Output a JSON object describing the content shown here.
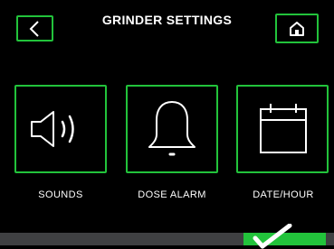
{
  "header": {
    "title": "GRINDER SETTINGS",
    "back_icon": "chevron-left-icon",
    "home_icon": "home-icon"
  },
  "tiles": [
    {
      "label": "SOUNDS",
      "icon": "speaker-icon"
    },
    {
      "label": "DOSE ALARM",
      "icon": "bell-icon"
    },
    {
      "label": "DATE/HOUR",
      "icon": "calendar-icon"
    }
  ],
  "colors": {
    "accent": "#22c33b",
    "background": "#000000",
    "bar": "#3f4042"
  }
}
